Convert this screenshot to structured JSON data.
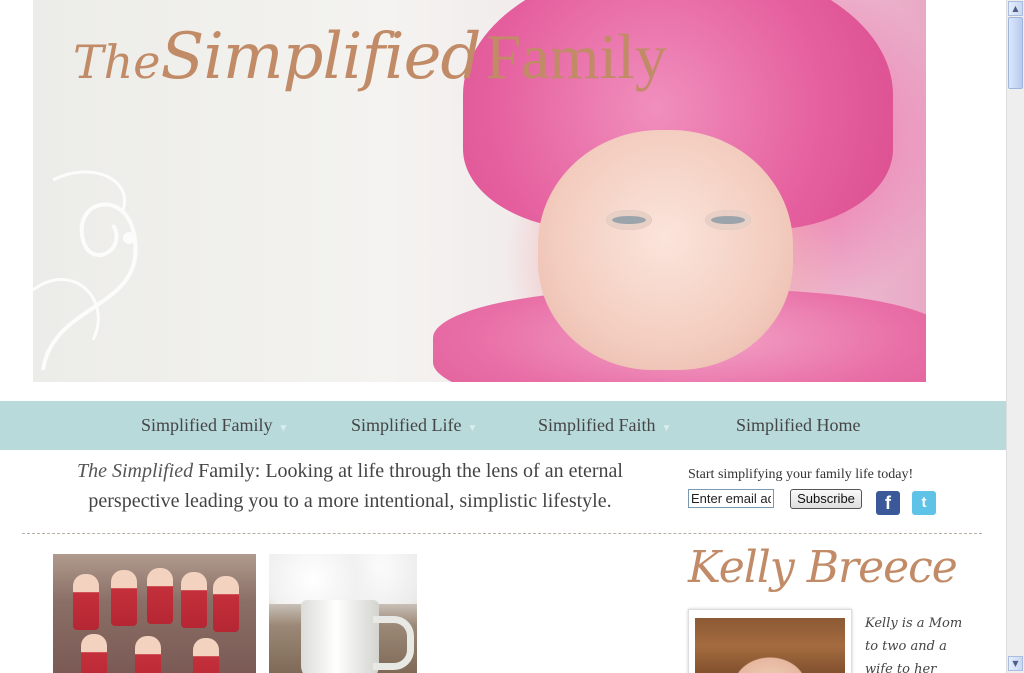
{
  "header": {
    "logo": {
      "the": "The",
      "simplified": "Simplified",
      "family": "Family"
    }
  },
  "nav": {
    "items": [
      {
        "label": "Simplified Family",
        "has_dropdown": true
      },
      {
        "label": "Simplified Life",
        "has_dropdown": true
      },
      {
        "label": "Simplified Faith",
        "has_dropdown": true
      },
      {
        "label": "Simplified Home",
        "has_dropdown": false
      }
    ]
  },
  "tagline": {
    "brand": "The Simplified",
    "family": "Family",
    "text": ": Looking at life through the lens of an eternal perspective leading you to a more intentional, simplistic lifestyle."
  },
  "subscribe": {
    "prompt": "Start simplifying your family life today!",
    "email_value": "Enter email address",
    "button_label": "Subscribe"
  },
  "social": {
    "facebook_glyph": "f",
    "twitter_glyph": "t"
  },
  "sidebar": {
    "author_name": "Kelly Breece",
    "bio": "Kelly is a Mom to two and a wife to her"
  },
  "scrollbar": {
    "up_glyph": "▲",
    "down_glyph": "▼"
  },
  "colors": {
    "nav_bg": "#b9dadb",
    "brand": "#c28b67",
    "facebook": "#3b5998",
    "twitter": "#5fc3e8"
  }
}
